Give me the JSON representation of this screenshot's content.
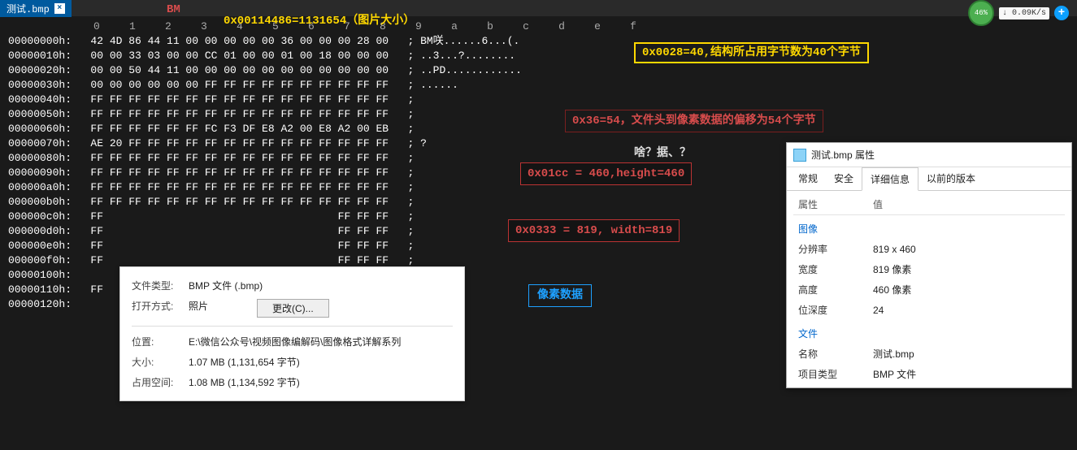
{
  "tab": {
    "name": "测试.bmp",
    "close": "×"
  },
  "netspeed": {
    "pct": "46%",
    "down": "↓",
    "rate": "0.09K/s"
  },
  "header_anno": "0x00114486=1131654（图片大小）",
  "bm_label": "BM",
  "anno_box_right": "0x0028=40,结构所占用字节数为40个字节",
  "anno_offset": "0x36=54，文件头到像素数据的偏移为54个字节",
  "anno_height": "0x01cc = 460,height=460",
  "anno_width": "0x0333 = 819, width=819",
  "anno_ascii_unknown": "啥？据、？",
  "anno_pixel": "像素数据",
  "col_header": "0    1    2    3    4    5    6    7    8    9    a    b    c    d    e    f",
  "hex_rows": [
    {
      "off": "00000000h:",
      "bytes": "42 4D 86 44 11 00 00 00 00 00 36 00 00 00 28 00",
      "asc": "; BM咲......6...(."
    },
    {
      "off": "00000010h:",
      "bytes": "00 00 33 03 00 00 CC 01 00 00 01 00 18 00 00 00",
      "asc": "; ..3...?........"
    },
    {
      "off": "00000020h:",
      "bytes": "00 00 50 44 11 00 00 00 00 00 00 00 00 00 00 00",
      "asc": "; ..PD............"
    },
    {
      "off": "00000030h:",
      "bytes": "00 00 00 00 00 00 FF FF FF FF FF FF FF FF FF FF",
      "asc": "; ......"
    },
    {
      "off": "00000040h:",
      "bytes": "FF FF FF FF FF FF FF FF FF FF FF FF FF FF FF FF",
      "asc": ";"
    },
    {
      "off": "00000050h:",
      "bytes": "FF FF FF FF FF FF FF FF FF FF FF FF FF FF FF FF",
      "asc": ";"
    },
    {
      "off": "00000060h:",
      "bytes": "FF FF FF FF FF FF FC F3 DF E8 A2 00 E8 A2 00 EB",
      "asc": ";"
    },
    {
      "off": "00000070h:",
      "bytes": "AE 20 FF FF FF FF FF FF FF FF FF FF FF FF FF FF",
      "asc": "; ?"
    },
    {
      "off": "00000080h:",
      "bytes": "FF FF FF FF FF FF FF FF FF FF FF FF FF FF FF FF",
      "asc": ";"
    },
    {
      "off": "00000090h:",
      "bytes": "FF FF FF FF FF FF FF FF FF FF FF FF FF FF FF FF",
      "asc": ";"
    },
    {
      "off": "000000a0h:",
      "bytes": "FF FF FF FF FF FF FF FF FF FF FF FF FF FF FF FF",
      "asc": ";"
    },
    {
      "off": "000000b0h:",
      "bytes": "FF FF FF FF FF FF FF FF FF FF FF FF FF FF FF FF",
      "asc": ";"
    },
    {
      "off": "000000c0h:",
      "bytes": "FF                                     FF FF FF",
      "asc": ";"
    },
    {
      "off": "000000d0h:",
      "bytes": "FF                                     FF FF FF",
      "asc": ";"
    },
    {
      "off": "000000e0h:",
      "bytes": "FF                                     FF FF FF",
      "asc": ";"
    },
    {
      "off": "000000f0h:",
      "bytes": "FF                                     FF FF FF",
      "asc": ";"
    },
    {
      "off": "00000100h:",
      "bytes": "                                                ",
      "asc": ""
    },
    {
      "off": "00000110h:",
      "bytes": "FF                                     FF FF FF",
      "asc": ";"
    },
    {
      "off": "00000120h:",
      "bytes": "",
      "asc": ""
    }
  ],
  "tooltip": {
    "filetype_k": "文件类型:",
    "filetype_v": "BMP 文件 (.bmp)",
    "openwith_k": "打开方式:",
    "openwith_v": "照片",
    "change_btn": "更改(C)...",
    "location_k": "位置:",
    "location_v": "E:\\微信公众号\\视频图像编解码\\图像格式详解系列",
    "size_k": "大小:",
    "size_v": "1.07 MB (1,131,654 字节)",
    "ondisk_k": "占用空间:",
    "ondisk_v": "1.08 MB (1,134,592 字节)"
  },
  "propwin": {
    "title": "测试.bmp 属性",
    "tabs": [
      "常规",
      "安全",
      "详细信息",
      "以前的版本"
    ],
    "col_prop": "属性",
    "col_val": "值",
    "sect_image": "图像",
    "res_k": "分辨率",
    "res_v": "819 x 460",
    "w_k": "宽度",
    "w_v": "819 像素",
    "h_k": "高度",
    "h_v": "460 像素",
    "depth_k": "位深度",
    "depth_v": "24",
    "sect_file": "文件",
    "name_k": "名称",
    "name_v": "测试.bmp",
    "type_k": "项目类型",
    "type_v": "BMP 文件"
  }
}
